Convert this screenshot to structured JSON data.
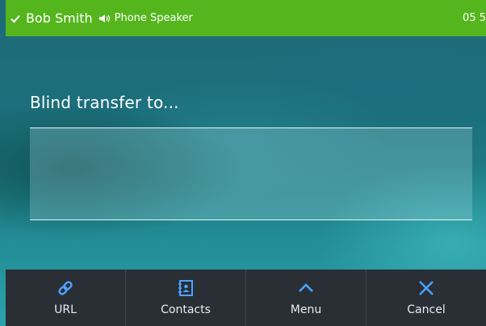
{
  "status_bar": {
    "caller_name": "Bob Smith",
    "audio_mode": "Phone Speaker",
    "time": "05 5",
    "background_color": "#55b51d"
  },
  "main": {
    "heading": "Blind transfer to..."
  },
  "softkeys": [
    {
      "label": "URL",
      "icon": "link-icon",
      "icon_color": "#4aa3ff"
    },
    {
      "label": "Contacts",
      "icon": "contacts-book-icon",
      "icon_color": "#4aa3ff"
    },
    {
      "label": "Menu",
      "icon": "chevron-up-icon",
      "icon_color": "#4aa3ff"
    },
    {
      "label": "Cancel",
      "icon": "close-icon",
      "icon_color": "#4aa3ff"
    }
  ]
}
